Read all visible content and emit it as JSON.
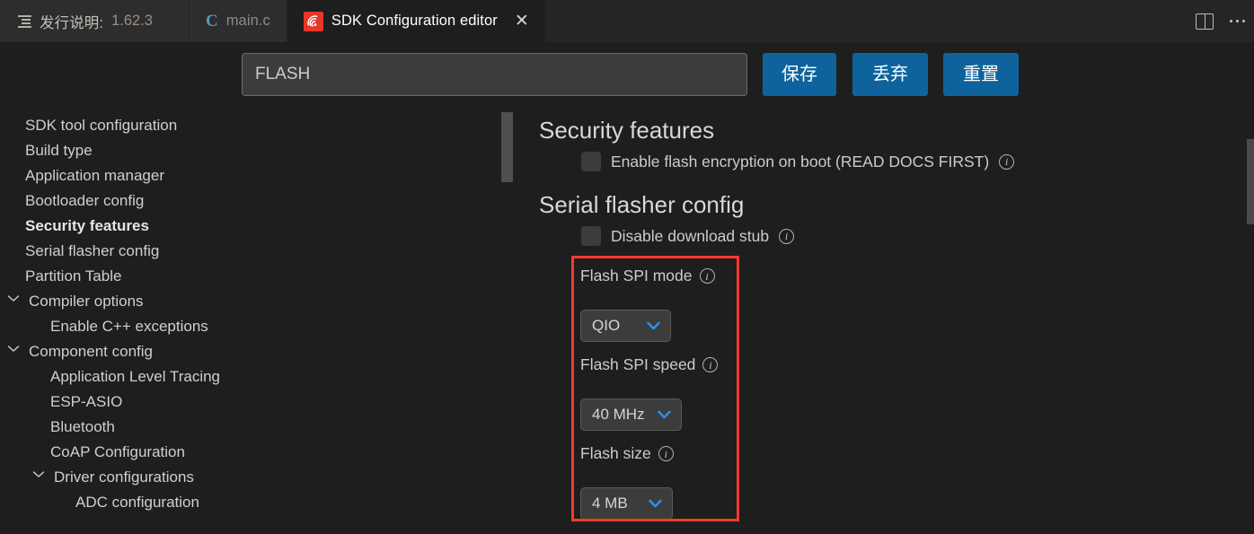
{
  "window": {
    "background": "#1e1e1e",
    "accent": "#0e639c",
    "annotation_color": "#f4392c"
  },
  "tabs": [
    {
      "label": "发行说明:",
      "version": "1.62.3",
      "icon": "lines-icon",
      "active": false,
      "closable": false
    },
    {
      "label": "main.c",
      "icon": "c-file-icon",
      "active": false,
      "closable": false
    },
    {
      "label": "SDK Configuration editor",
      "icon": "esp-idf-icon",
      "active": true,
      "closable": true,
      "close_glyph": "✕"
    }
  ],
  "tab_actions": {
    "split_editor": "split-editor-icon",
    "more": "more-actions-icon"
  },
  "toolbar": {
    "search_value": "FLASH",
    "search_placeholder": "Search parameter",
    "save_label": "保存",
    "discard_label": "丢弃",
    "reset_label": "重置"
  },
  "sidebar": {
    "items": [
      {
        "label": "SDK tool configuration",
        "indent": 0,
        "chevron": false,
        "selected": false
      },
      {
        "label": "Build type",
        "indent": 0,
        "chevron": false,
        "selected": false
      },
      {
        "label": "Application manager",
        "indent": 0,
        "chevron": false,
        "selected": false
      },
      {
        "label": "Bootloader config",
        "indent": 0,
        "chevron": false,
        "selected": false
      },
      {
        "label": "Security features",
        "indent": 0,
        "chevron": false,
        "selected": true
      },
      {
        "label": "Serial flasher config",
        "indent": 0,
        "chevron": false,
        "selected": false
      },
      {
        "label": "Partition Table",
        "indent": 0,
        "chevron": false,
        "selected": false
      },
      {
        "label": "Compiler options",
        "indent": 1,
        "chevron": true,
        "selected": false
      },
      {
        "label": "Enable C++ exceptions",
        "indent": 2,
        "chevron": false,
        "selected": false
      },
      {
        "label": "Component config",
        "indent": 1,
        "chevron": true,
        "selected": false
      },
      {
        "label": "Application Level Tracing",
        "indent": 2,
        "chevron": false,
        "selected": false
      },
      {
        "label": "ESP-ASIO",
        "indent": 2,
        "chevron": false,
        "selected": false
      },
      {
        "label": "Bluetooth",
        "indent": 2,
        "chevron": false,
        "selected": false
      },
      {
        "label": "CoAP Configuration",
        "indent": 2,
        "chevron": false,
        "selected": false
      },
      {
        "label": "Driver configurations",
        "indent": 3,
        "chevron": true,
        "selected": false
      },
      {
        "label": "ADC configuration",
        "indent": 4,
        "chevron": false,
        "selected": false
      }
    ]
  },
  "content": {
    "sections": [
      {
        "title": "Security features",
        "checkboxes": [
          {
            "label": "Enable flash encryption on boot (READ DOCS FIRST)",
            "checked": false,
            "info": "info-icon"
          }
        ]
      },
      {
        "title": "Serial flasher config",
        "checkboxes": [
          {
            "label": "Disable download stub",
            "checked": false,
            "info": "info-icon"
          }
        ]
      }
    ],
    "fields": [
      {
        "label": "Flash SPI mode",
        "value": "QIO",
        "info": "info-icon"
      },
      {
        "label": "Flash SPI speed",
        "value": "40 MHz",
        "info": "info-icon"
      },
      {
        "label": "Flash size",
        "value": "4 MB",
        "info": "info-icon"
      }
    ]
  }
}
